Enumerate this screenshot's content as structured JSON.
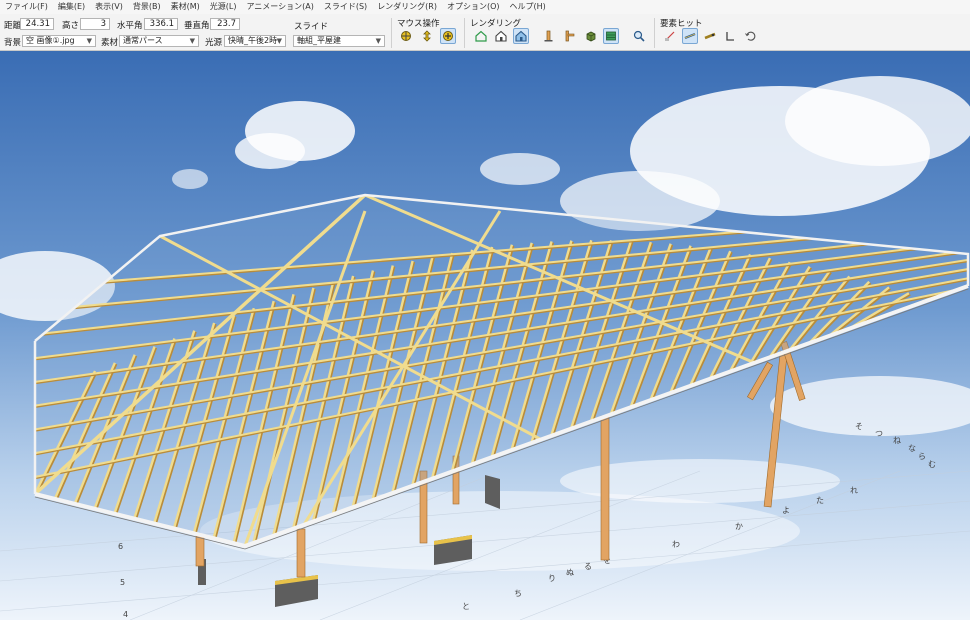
{
  "menu": [
    "ファイル(F)",
    "編集(E)",
    "表示(V)",
    "背景(B)",
    "素材(M)",
    "光源(L)",
    "アニメーション(A)",
    "スライド(S)",
    "レンダリング(R)",
    "オプション(O)",
    "ヘルプ(H)"
  ],
  "toolbar": {
    "distance_label": "距離",
    "distance_value": "24.31",
    "height_label": "高さ",
    "height_value": "3",
    "horizontal_angle_label": "水平角",
    "horizontal_angle_value": "336.1",
    "vertical_angle_label": "垂直角",
    "vertical_angle_value": "23.7",
    "background_label": "背景",
    "background_value": "空 画像①.jpg",
    "material_label": "素材",
    "material_value": "通常パース",
    "light_label": "光源",
    "light_value": "快晴_午後2時",
    "slide_label": "スライド",
    "slide_value": "軸組_平屋建",
    "mouse_group_label": "マウス操作",
    "rendering_group_label": "レンダリング",
    "element_hit_group_label": "要素ヒット"
  },
  "grid_labels": {
    "left_numbers": [
      "6",
      "5",
      "4"
    ],
    "bottom_kana": [
      "と",
      "ち",
      "り",
      "ぬ",
      "る",
      "を",
      "わ",
      "か",
      "よ",
      "た",
      "れ"
    ],
    "far_kana": [
      "そ",
      "つ",
      "ね",
      "な",
      "ら",
      "む"
    ]
  },
  "colors": {
    "sky_top": "#3a6db4",
    "sky_bottom": "#e9f1fa",
    "timber": "#f0dc8e",
    "timber_shadow": "#b98c3a",
    "post": "#e2a463",
    "roof_edge": "#f4f4f4",
    "foundation": "#5e5e5e",
    "active_button": "#cfe3f7"
  },
  "icons": {
    "mouse": [
      "rotate-icon",
      "pan-icon",
      "zoom-icon"
    ],
    "rendering": [
      "house-wire-icon",
      "house-outline-icon",
      "house-shaded-icon",
      "column-icon",
      "beam-icon",
      "cube-icon",
      "layers-icon",
      "magnifier-icon"
    ],
    "element_hit": [
      "hit-brace-icon",
      "hit-stud-icon",
      "hit-beam-icon",
      "hit-corner-icon",
      "hit-undo-icon"
    ]
  }
}
